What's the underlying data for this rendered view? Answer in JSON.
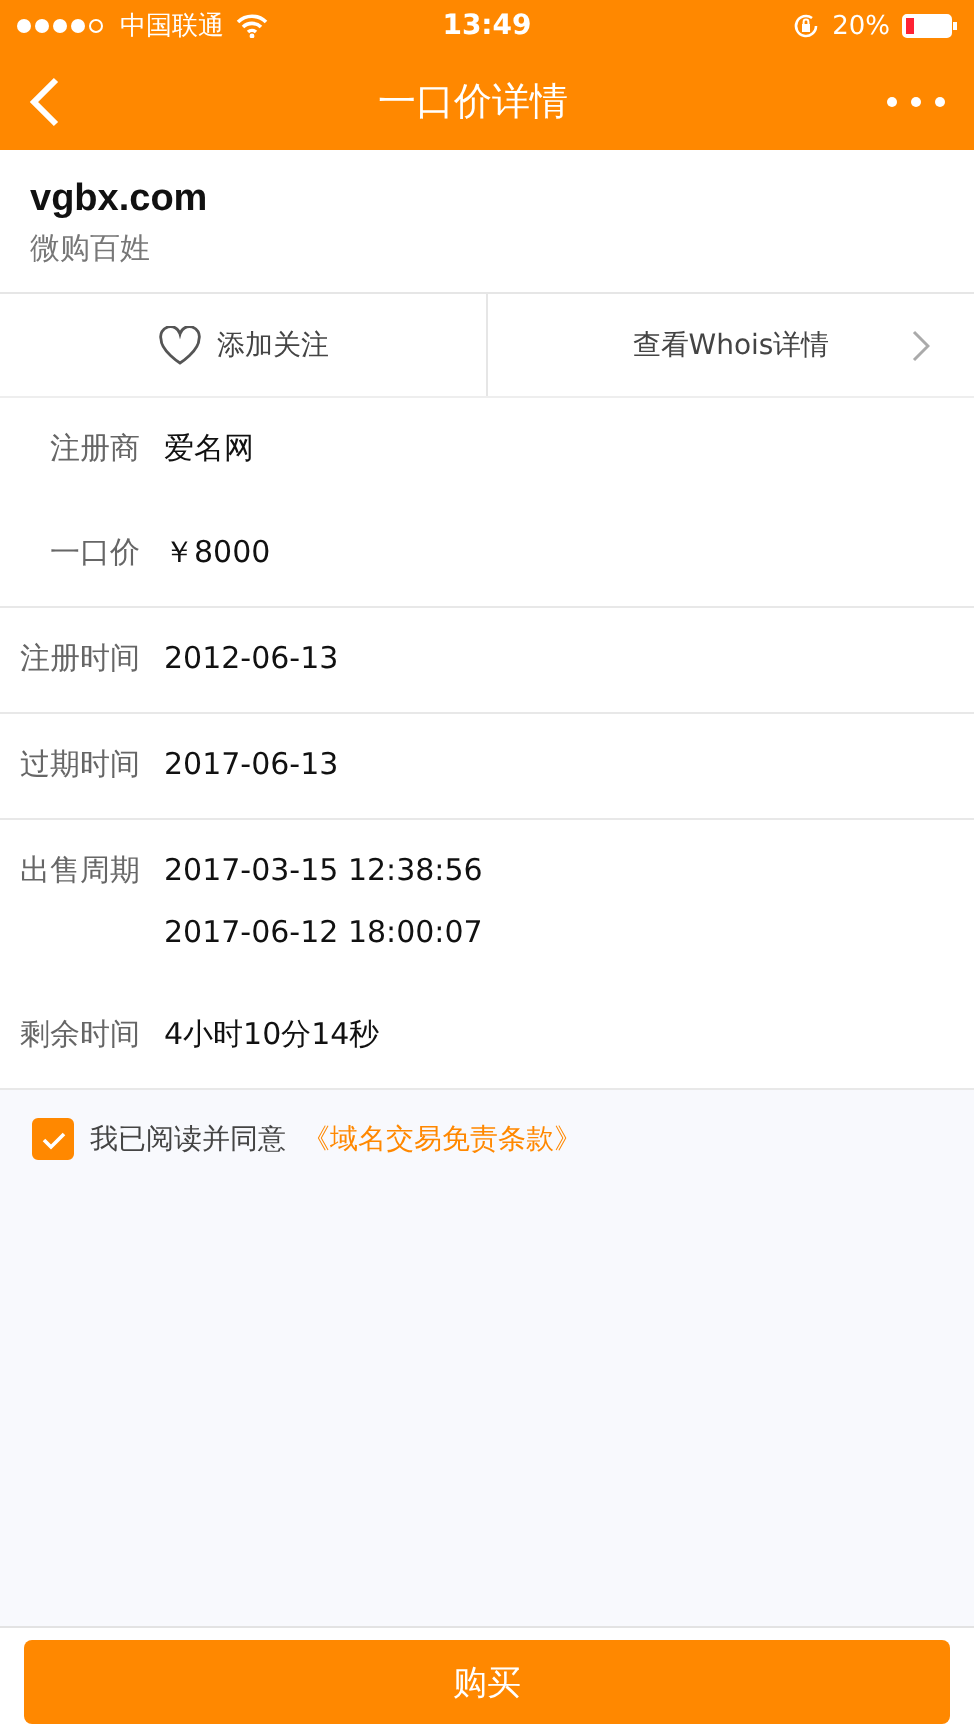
{
  "status_bar": {
    "carrier": "中国联通",
    "time": "13:49",
    "battery": "20%"
  },
  "nav": {
    "title": "一口价详情"
  },
  "domain": {
    "name": "vgbx.com",
    "subtitle": "微购百姓"
  },
  "actions": {
    "follow": "添加关注",
    "whois": "查看Whois详情"
  },
  "groups": [
    [
      {
        "label": "注册商",
        "values": [
          "爱名网"
        ]
      },
      {
        "label": "一口价",
        "values": [
          "￥8000"
        ]
      }
    ],
    [
      {
        "label": "注册时间",
        "values": [
          "2012-06-13"
        ]
      }
    ],
    [
      {
        "label": "过期时间",
        "values": [
          "2017-06-13"
        ]
      }
    ],
    [
      {
        "label": "出售周期",
        "values": [
          "2017-03-15 12:38:56",
          "2017-06-12 18:00:07"
        ]
      },
      {
        "label": "剩余时间",
        "values": [
          "4小时10分14秒"
        ]
      }
    ]
  ],
  "agreement": {
    "checked": true,
    "text": "我已阅读并同意",
    "link": "《域名交易免责条款》"
  },
  "buy_button": "购买"
}
